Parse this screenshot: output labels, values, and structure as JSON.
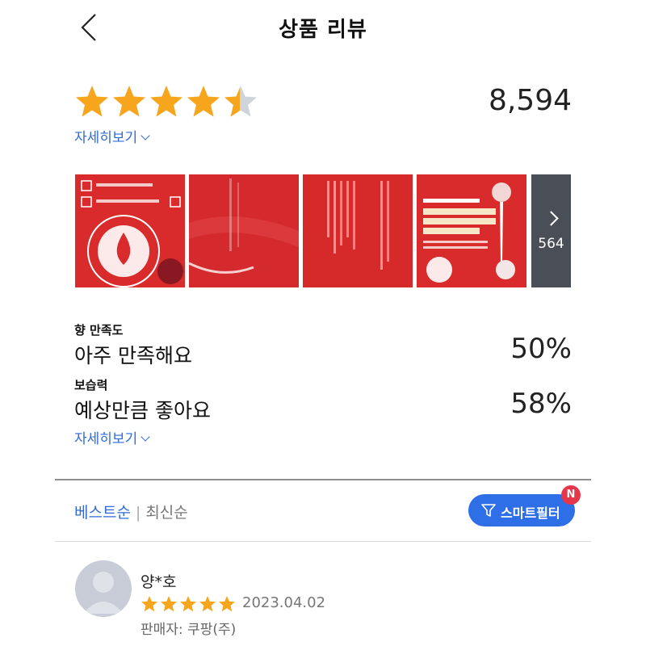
{
  "header": {
    "title": "상품 리뷰"
  },
  "summary": {
    "rating": 4.5,
    "rating_max": 5,
    "review_count": "8,594",
    "more_label": "자세히보기"
  },
  "photos": {
    "more_count": "564"
  },
  "survey": {
    "items": [
      {
        "label": "향 만족도",
        "answer": "아주 만족해요",
        "percent": "50%"
      },
      {
        "label": "보습력",
        "answer": "예상만큼 좋아요",
        "percent": "58%"
      }
    ],
    "more_label": "자세히보기"
  },
  "sort": {
    "best": "베스트순",
    "separator": "|",
    "latest": "최신순"
  },
  "smart_filter": {
    "label": "스마트필터",
    "badge": "N"
  },
  "review": {
    "reviewer": "양*호",
    "rating": 5,
    "date": "2023.04.02",
    "seller": "판매자: 쿠팡(주)"
  },
  "colors": {
    "accent": "#2f6bd6",
    "star": "#f7a51c",
    "star_empty": "#cfd3da",
    "badge": "#e6364a",
    "product_red": "#d92b2b"
  }
}
